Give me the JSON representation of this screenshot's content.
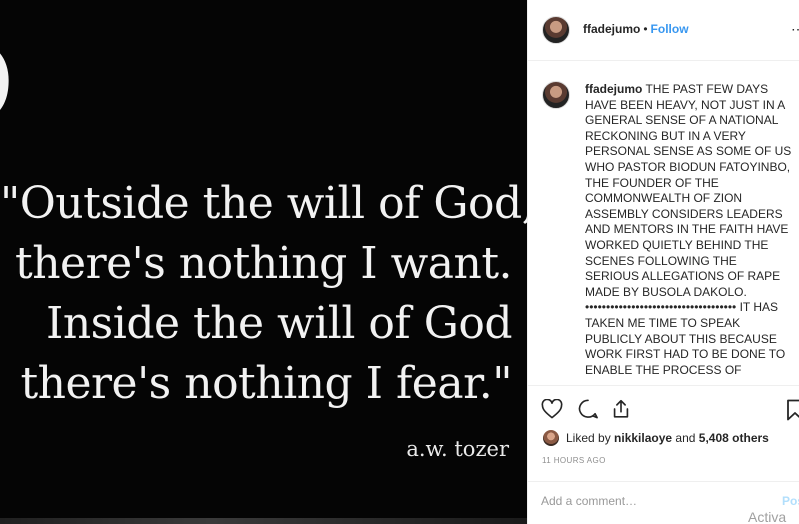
{
  "media": {
    "quote_lines": [
      "\"Outside the will of God,",
      "there's nothing I want.",
      "Inside the will of God",
      "there's nothing I fear.\""
    ],
    "author": "a.w. tozer"
  },
  "header": {
    "username": "ffadejumo",
    "separator": "•",
    "follow_label": "Follow",
    "more_icon": "⋯"
  },
  "caption": {
    "username": "ffadejumo",
    "text": "THE PAST FEW DAYS HAVE BEEN HEAVY, NOT JUST IN A GENERAL SENSE OF A NATIONAL RECKONING BUT IN A VERY PERSONAL SENSE AS SOME OF US WHO PASTOR BIODUN FATOYINBO, THE FOUNDER OF THE COMMONWEALTH OF ZION ASSEMBLY CONSIDERS LEADERS AND MENTORS IN THE FAITH HAVE WORKED QUIETLY BEHIND THE SCENES FOLLOWING THE SERIOUS ALLEGATIONS OF RAPE MADE BY BUSOLA DAKOLO. •••••••••••••••••••••••••••••••••••• IT HAS TAKEN ME TIME TO SPEAK PUBLICLY ABOUT THIS BECAUSE WORK FIRST HAD TO BE DONE TO ENABLE THE PROCESS OF"
  },
  "actions": {
    "icons": [
      "heart-icon",
      "comment-icon",
      "share-icon",
      "bookmark-icon"
    ]
  },
  "likes": {
    "prefix": "Liked by",
    "user": "nikkilaoye",
    "middle": "and",
    "others": "5,408 others"
  },
  "timestamp": "11 HOURS AGO",
  "comment": {
    "placeholder": "Add a comment…",
    "post_label": "Post"
  },
  "watermark": "Activa"
}
